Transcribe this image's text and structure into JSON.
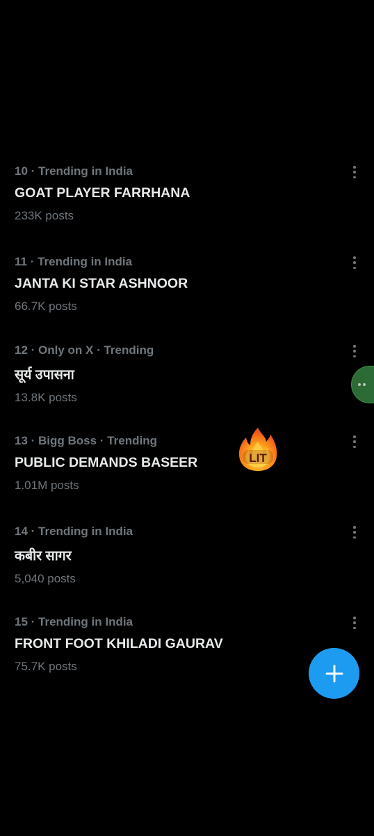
{
  "trends": [
    {
      "meta": "10 · Trending in India",
      "title": "GOAT PLAYER FARRHANA",
      "count": "233K posts"
    },
    {
      "meta": "11 · Trending in India",
      "title": "JANTA KI STAR ASHNOOR",
      "count": "66.7K posts"
    },
    {
      "meta": "12 · Only on X · Trending",
      "title": "सूर्य उपासना",
      "count": "13.8K posts"
    },
    {
      "meta": "13 · Bigg Boss · Trending",
      "title": "PUBLIC DEMANDS BASEER",
      "count": "1.01M posts"
    },
    {
      "meta": "14 · Trending in India",
      "title": "कबीर सागर",
      "count": "5,040 posts"
    },
    {
      "meta": "15 · Trending in India",
      "title": "FRONT FOOT KHILADI GAURAV",
      "count": "75.7K posts"
    }
  ],
  "sticker": {
    "text": "LIT",
    "icon": "fire-icon"
  },
  "fab": {
    "icon": "plus-icon",
    "color": "#1d9bf0"
  },
  "colors": {
    "background": "#000000",
    "primary_text": "#e7e9ea",
    "secondary_text": "#71767b"
  }
}
